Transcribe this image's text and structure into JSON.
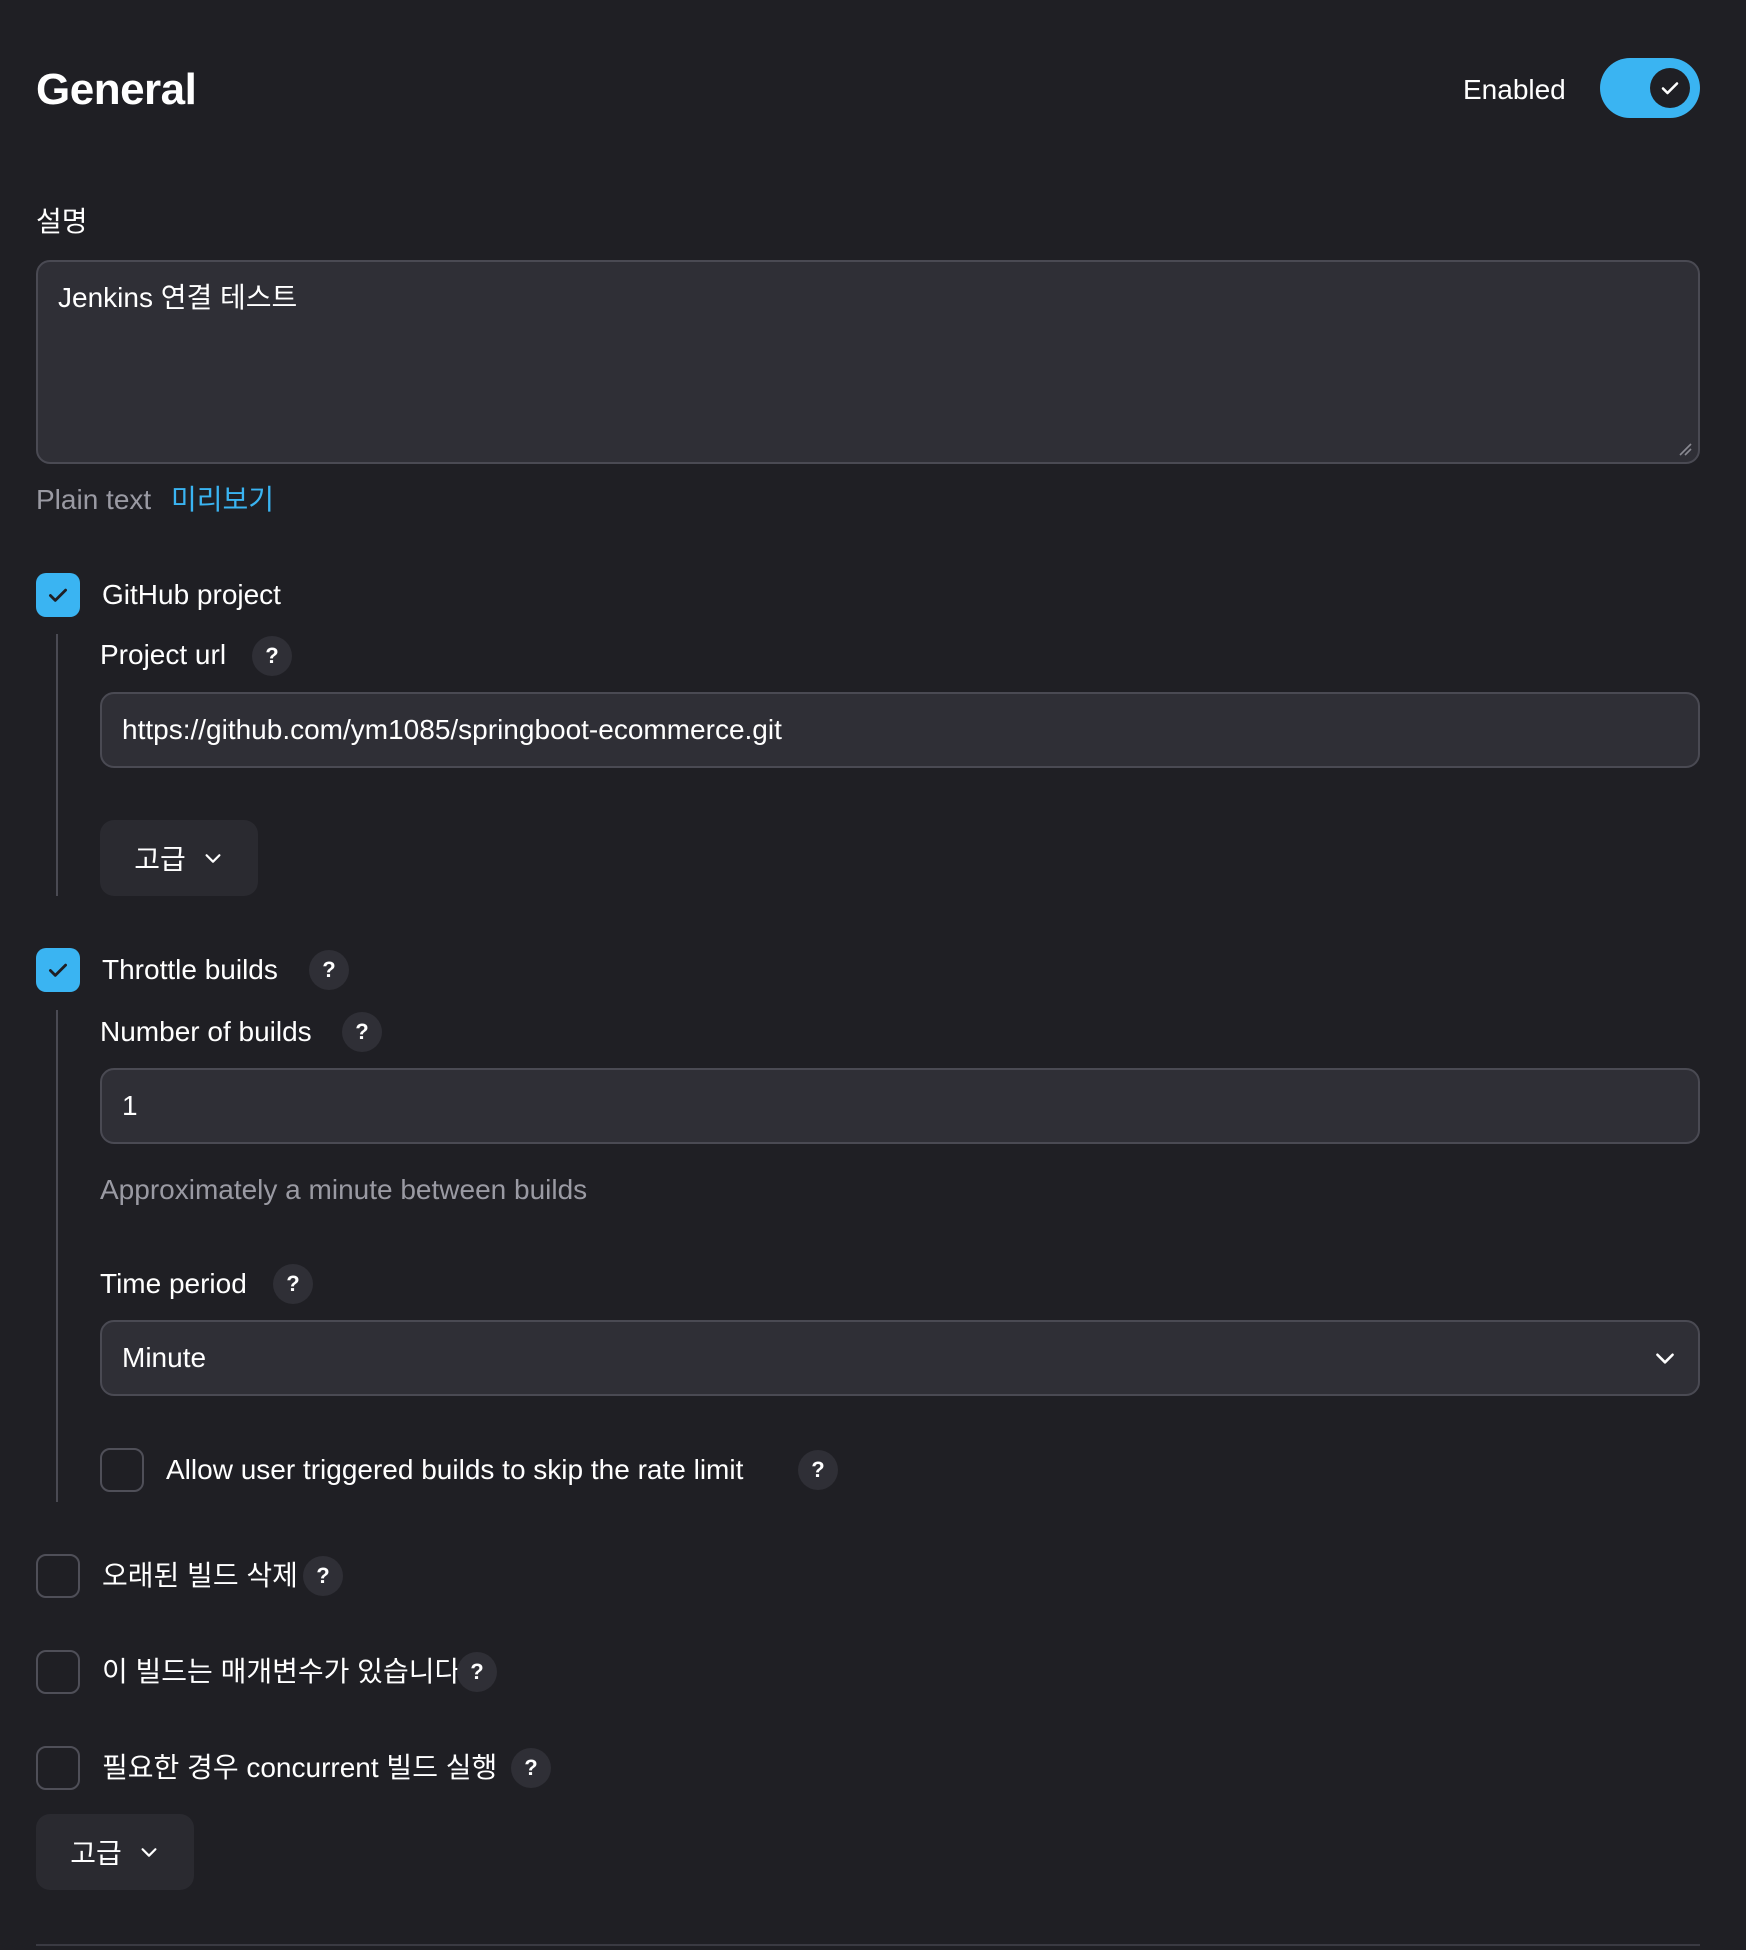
{
  "header": {
    "title": "General",
    "enabled_label": "Enabled"
  },
  "description": {
    "label": "설명",
    "value": "Jenkins 연결 테스트",
    "plain_text": "Plain text",
    "preview_link": "미리보기"
  },
  "github_project": {
    "label": "GitHub project",
    "checked": true,
    "project_url_label": "Project url",
    "project_url_value": "https://github.com/ym1085/springboot-ecommerce.git",
    "advanced_label": "고급"
  },
  "throttle_builds": {
    "label": "Throttle builds",
    "checked": true,
    "number_label": "Number of builds",
    "number_value": "1",
    "number_hint": "Approximately a minute between builds",
    "time_period_label": "Time period",
    "time_period_value": "Minute",
    "skip_rate_limit_label": "Allow user triggered builds to skip the rate limit",
    "skip_rate_limit_checked": false
  },
  "options": [
    {
      "label": "오래된 빌드 삭제",
      "checked": false
    },
    {
      "label": "이 빌드는 매개변수가 있습니다",
      "checked": false
    },
    {
      "label": "필요한 경우 concurrent 빌드 실행",
      "checked": false
    }
  ],
  "advanced_bottom_label": "고급",
  "help_glyph": "?",
  "colors": {
    "background": "#1f1f24",
    "accent": "#3ab4f2",
    "field": "#2f2f36",
    "border": "#4a4a53",
    "muted_text": "#9a9aa3"
  }
}
